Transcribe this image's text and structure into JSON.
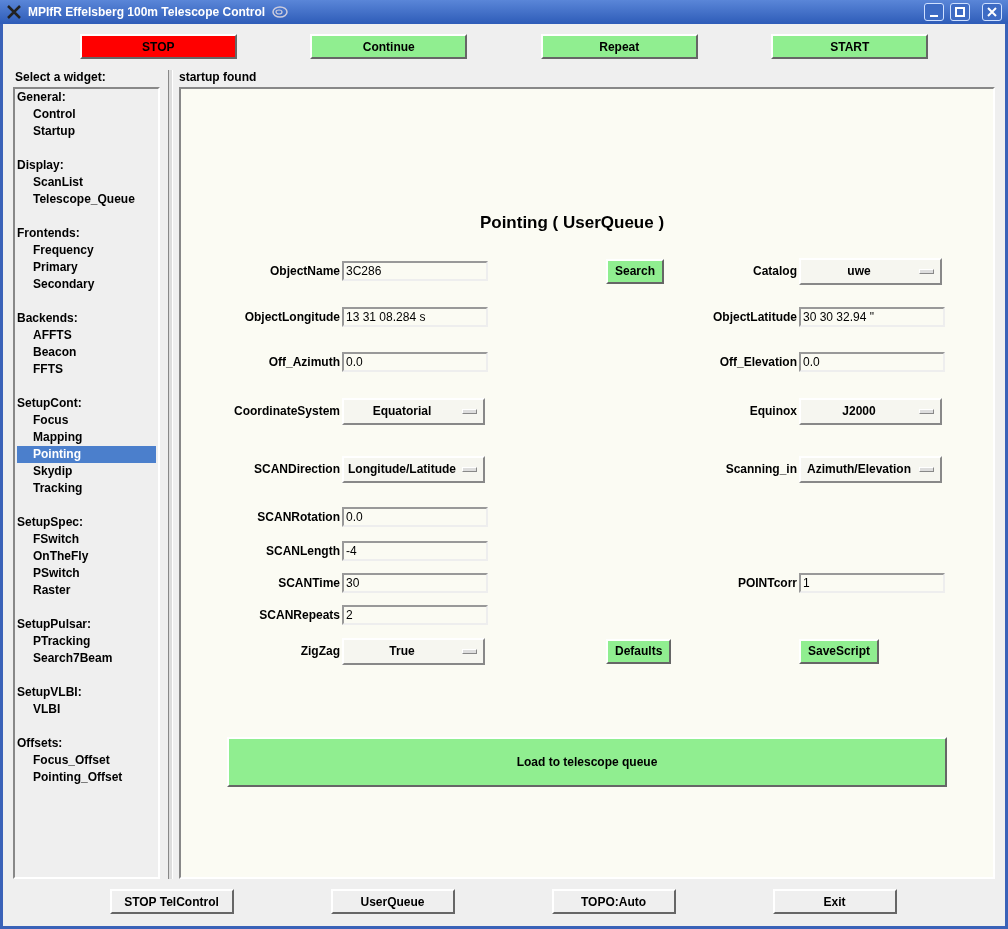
{
  "window": {
    "title": "MPIfR Effelsberg 100m Telescope Control"
  },
  "top_buttons": [
    {
      "label": "STOP",
      "kind": "danger"
    },
    {
      "label": "Continue",
      "kind": "go"
    },
    {
      "label": "Repeat",
      "kind": "go"
    },
    {
      "label": "START",
      "kind": "go"
    }
  ],
  "sidebar": {
    "title": "Select a widget:",
    "groups": [
      {
        "label": "General:",
        "children": [
          {
            "label": "Control",
            "selected": false
          },
          {
            "label": "Startup",
            "selected": false
          }
        ]
      },
      {
        "label": "Display:",
        "children": [
          {
            "label": "ScanList",
            "selected": false
          },
          {
            "label": "Telescope_Queue",
            "selected": false
          }
        ]
      },
      {
        "label": "Frontends:",
        "children": [
          {
            "label": "Frequency",
            "selected": false
          },
          {
            "label": "Primary",
            "selected": false
          },
          {
            "label": "Secondary",
            "selected": false
          }
        ]
      },
      {
        "label": "Backends:",
        "children": [
          {
            "label": "AFFTS",
            "selected": false
          },
          {
            "label": "Beacon",
            "selected": false
          },
          {
            "label": "FFTS",
            "selected": false
          }
        ]
      },
      {
        "label": "SetupCont:",
        "children": [
          {
            "label": "Focus",
            "selected": false
          },
          {
            "label": "Mapping",
            "selected": false
          },
          {
            "label": "Pointing",
            "selected": true
          },
          {
            "label": "Skydip",
            "selected": false
          },
          {
            "label": "Tracking",
            "selected": false
          }
        ]
      },
      {
        "label": "SetupSpec:",
        "children": [
          {
            "label": "FSwitch",
            "selected": false
          },
          {
            "label": "OnTheFly",
            "selected": false
          },
          {
            "label": "PSwitch",
            "selected": false
          },
          {
            "label": "Raster",
            "selected": false
          }
        ]
      },
      {
        "label": "SetupPulsar:",
        "children": [
          {
            "label": "PTracking",
            "selected": false
          },
          {
            "label": "Search7Beam",
            "selected": false
          }
        ]
      },
      {
        "label": "SetupVLBI:",
        "children": [
          {
            "label": "VLBI",
            "selected": false
          }
        ]
      },
      {
        "label": "Offsets:",
        "children": [
          {
            "label": "Focus_Offset",
            "selected": false
          },
          {
            "label": "Pointing_Offset",
            "selected": false
          }
        ]
      }
    ]
  },
  "status": "startup found",
  "form": {
    "title": "Pointing ( UserQueue )",
    "rows": [
      {
        "left": {
          "label": "ObjectName",
          "kind": "text",
          "value": "3C286"
        },
        "center": {
          "label": "Search"
        },
        "right": {
          "label": "Catalog",
          "kind": "dropdown",
          "value": "uwe"
        }
      },
      {
        "left": {
          "label": "ObjectLongitude",
          "kind": "text",
          "value": "13 31 08.284 s"
        },
        "right": {
          "label": "ObjectLatitude",
          "kind": "text",
          "value": "30 30 32.94 \""
        }
      },
      {
        "left": {
          "label": "Off_Azimuth",
          "kind": "text",
          "value": "0.0"
        },
        "right": {
          "label": "Off_Elevation",
          "kind": "text",
          "value": "0.0"
        }
      },
      {
        "left": {
          "label": "CoordinateSystem",
          "kind": "dropdown",
          "value": "Equatorial"
        },
        "right": {
          "label": "Equinox",
          "kind": "dropdown",
          "value": "J2000"
        }
      },
      {
        "left": {
          "label": "SCANDirection",
          "kind": "dropdown",
          "value": "Longitude/Latitude"
        },
        "right": {
          "label": "Scanning_in",
          "kind": "dropdown",
          "value": "Azimuth/Elevation"
        }
      },
      {
        "left": {
          "label": "SCANRotation",
          "kind": "text",
          "value": "0.0"
        }
      },
      {
        "left": {
          "label": "SCANLength",
          "kind": "text",
          "value": "-4"
        }
      },
      {
        "left": {
          "label": "SCANTime",
          "kind": "text",
          "value": "30"
        },
        "right": {
          "label": "POINTcorr",
          "kind": "text",
          "value": "1"
        }
      },
      {
        "left": {
          "label": "SCANRepeats",
          "kind": "text",
          "value": "2"
        }
      },
      {
        "left": {
          "label": "ZigZag",
          "kind": "dropdown",
          "value": "True"
        },
        "center": {
          "label": "Defaults"
        },
        "right": {
          "label": "SaveScript",
          "kind": "button"
        }
      }
    ],
    "load_button": "Load to telescope queue"
  },
  "bottom_buttons": [
    "STOP TelControl",
    "UserQueue",
    "TOPO:Auto",
    "Exit"
  ]
}
